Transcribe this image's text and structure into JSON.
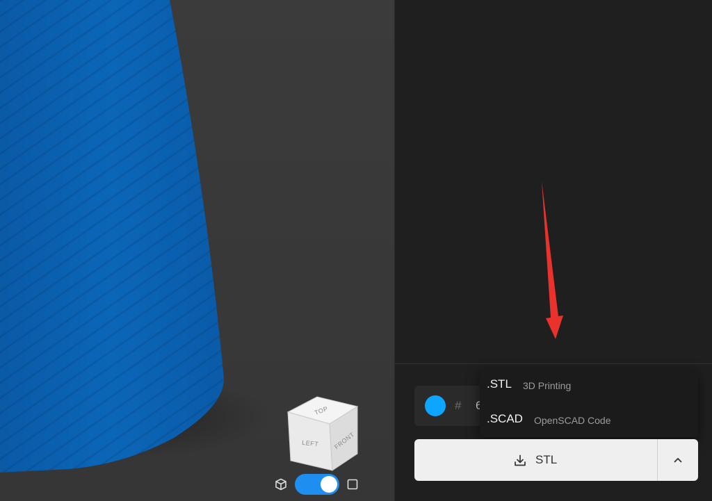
{
  "viewport": {
    "model_color": "#0a64b4",
    "view_cube": {
      "top_label": "TOP",
      "left_label": "LEFT",
      "front_label": "FRONT"
    },
    "projection": {
      "perspective_icon": "perspective-cube-icon",
      "orthographic_icon": "orthographic-square-icon",
      "toggle_on": true,
      "toggle_color": "#1e8ff0"
    }
  },
  "annotation": {
    "arrow_color": "#e8322b"
  },
  "color_picker": {
    "swatch_color": "#0ea5ff",
    "hash_symbol": "#",
    "value_visible": "6"
  },
  "export_menu": {
    "items": [
      {
        "extension": ".STL",
        "description": "3D Printing"
      },
      {
        "extension": ".SCAD",
        "description": "OpenSCAD Code"
      }
    ]
  },
  "export_button": {
    "icon": "download-icon",
    "label": "STL",
    "toggle_icon": "chevron-up-icon"
  }
}
